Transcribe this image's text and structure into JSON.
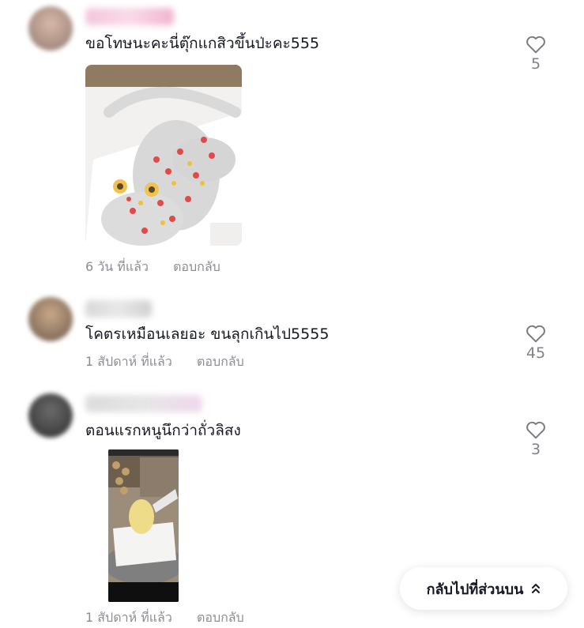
{
  "comments": [
    {
      "text": "ขอโทษนะคะนี่ตุ๊กแกสิวขึ้นป่ะคะ555",
      "time": "6 วัน ที่แล้ว",
      "reply_label": "ตอบกลับ",
      "likes": "5",
      "has_image": true
    },
    {
      "text": "โคตรเหมือนเลยอะ ขนลุกเกินไป5555",
      "time": "1 สัปดาห์ ที่แล้ว",
      "reply_label": "ตอบกลับ",
      "likes": "45",
      "has_image": false
    },
    {
      "text": "ตอนแรกหนูนึกว่าถั่วลิสง",
      "time": "1 สัปดาห์ ที่แล้ว",
      "reply_label": "ตอบกลับ",
      "likes": "3",
      "has_image": true
    }
  ],
  "back_to_top": {
    "label": "กลับไปที่ส่วนบน",
    "icon": "double-chevron-up-icon"
  },
  "colors": {
    "text_primary": "#161823",
    "text_secondary": "#8a8b91",
    "background": "#ffffff"
  }
}
